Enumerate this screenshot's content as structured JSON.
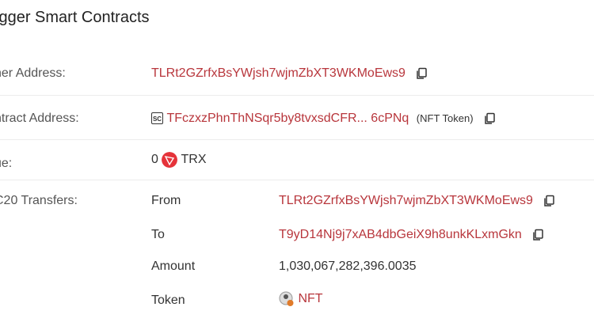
{
  "title": "igger Smart Contracts",
  "rows": {
    "owner": {
      "label": "ner Address:",
      "value": "TLRt2GZrfxBsYWjsh7wjmZbXT3WKMoEws9"
    },
    "contract": {
      "label": "ntract Address:",
      "value": "TFczxzPhnThNSqr5by8tvxsdCFR... 6cPNq",
      "tag": "(NFT Token)",
      "badge": "SC"
    },
    "value": {
      "label": "ue:",
      "amount": "0",
      "unit": "TRX"
    },
    "transfers": {
      "label": "C20 Transfers:",
      "from_label": "From",
      "from_value": "TLRt2GZrfxBsYWjsh7wjmZbXT3WKMoEws9",
      "to_label": "To",
      "to_value": "T9yD14Nj9j7xAB4dbGeiX9h8unkKLxmGkn",
      "amount_label": "Amount",
      "amount_value": "1,030,067,282,396.0035",
      "token_label": "Token",
      "token_value": "NFT"
    }
  },
  "colors": {
    "link": "#b8363c",
    "trx_icon": "#e5333a",
    "divider": "#ececec"
  },
  "icons": [
    "copy-icon",
    "smart-contract-badge-icon",
    "trx-icon",
    "nft-token-icon"
  ]
}
